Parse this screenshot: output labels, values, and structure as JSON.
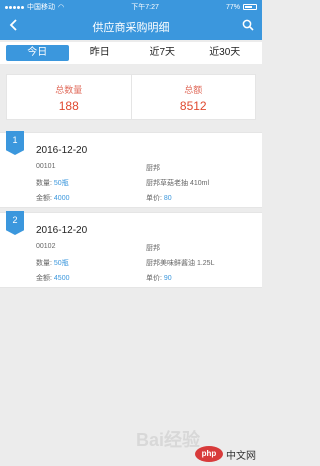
{
  "status": {
    "carrier": "中国移动",
    "wifi": "wifi",
    "time": "下午7:27",
    "battery": "77%"
  },
  "header": {
    "title": "供应商采购明细",
    "back_icon": "chevron-left-icon",
    "search_icon": "search-icon"
  },
  "tabs": [
    {
      "label": "今日",
      "active": true
    },
    {
      "label": "昨日",
      "active": false
    },
    {
      "label": "近7天",
      "active": false
    },
    {
      "label": "近30天",
      "active": false
    }
  ],
  "totals": {
    "count_label": "总数量",
    "count_value": "188",
    "amount_label": "总额",
    "amount_value": "8512"
  },
  "records": [
    {
      "index": "1",
      "date": "2016-12-20",
      "code": "00101",
      "brand": "厨邦",
      "qty_label": "数量:",
      "qty": "50瓶",
      "product": "厨邦草菇老抽 410ml",
      "amount_label": "金额:",
      "amount": "4000",
      "price_label": "单价:",
      "price": "80"
    },
    {
      "index": "2",
      "date": "2016-12-20",
      "code": "00102",
      "brand": "厨邦",
      "qty_label": "数量:",
      "qty": "50瓶",
      "product": "厨邦美味鲜酱油 1.25L",
      "amount_label": "金额:",
      "amount": "4500",
      "price_label": "单价:",
      "price": "90"
    }
  ],
  "watermark": {
    "baidu": "Bai经验",
    "php_logo": "php",
    "php_text": "中文网"
  },
  "colors": {
    "primary": "#3b97dd",
    "accent": "#e0492f"
  }
}
